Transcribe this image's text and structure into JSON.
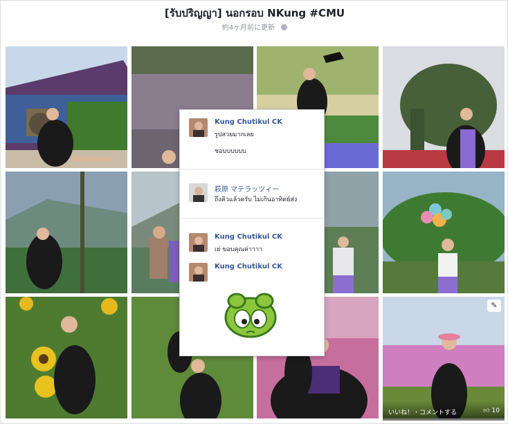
{
  "album": {
    "title": "[รับปริญญา] นอกรอบ NKung #CMU",
    "meta": "約4ヶ月前に更新"
  },
  "comments": [
    {
      "name": "Kung Chutikul CK",
      "lines": [
        "รูปสวยมากเลย",
        "ชอบบบบบบ"
      ]
    },
    {
      "name": "萩原 マテラッツィー",
      "lines": [
        "ถึงคิวแล้วครับ ไม่เกินอาทิตย์ส่ง"
      ]
    },
    {
      "name": "Kung Chutikul CK",
      "lines": [
        "เย่ ขอบคุณค่าาาา"
      ]
    },
    {
      "name": "Kung Chutikul CK",
      "lines": []
    }
  ],
  "photo_actions": {
    "like_comment": "いいね！・コメントする",
    "like_count": "10"
  }
}
